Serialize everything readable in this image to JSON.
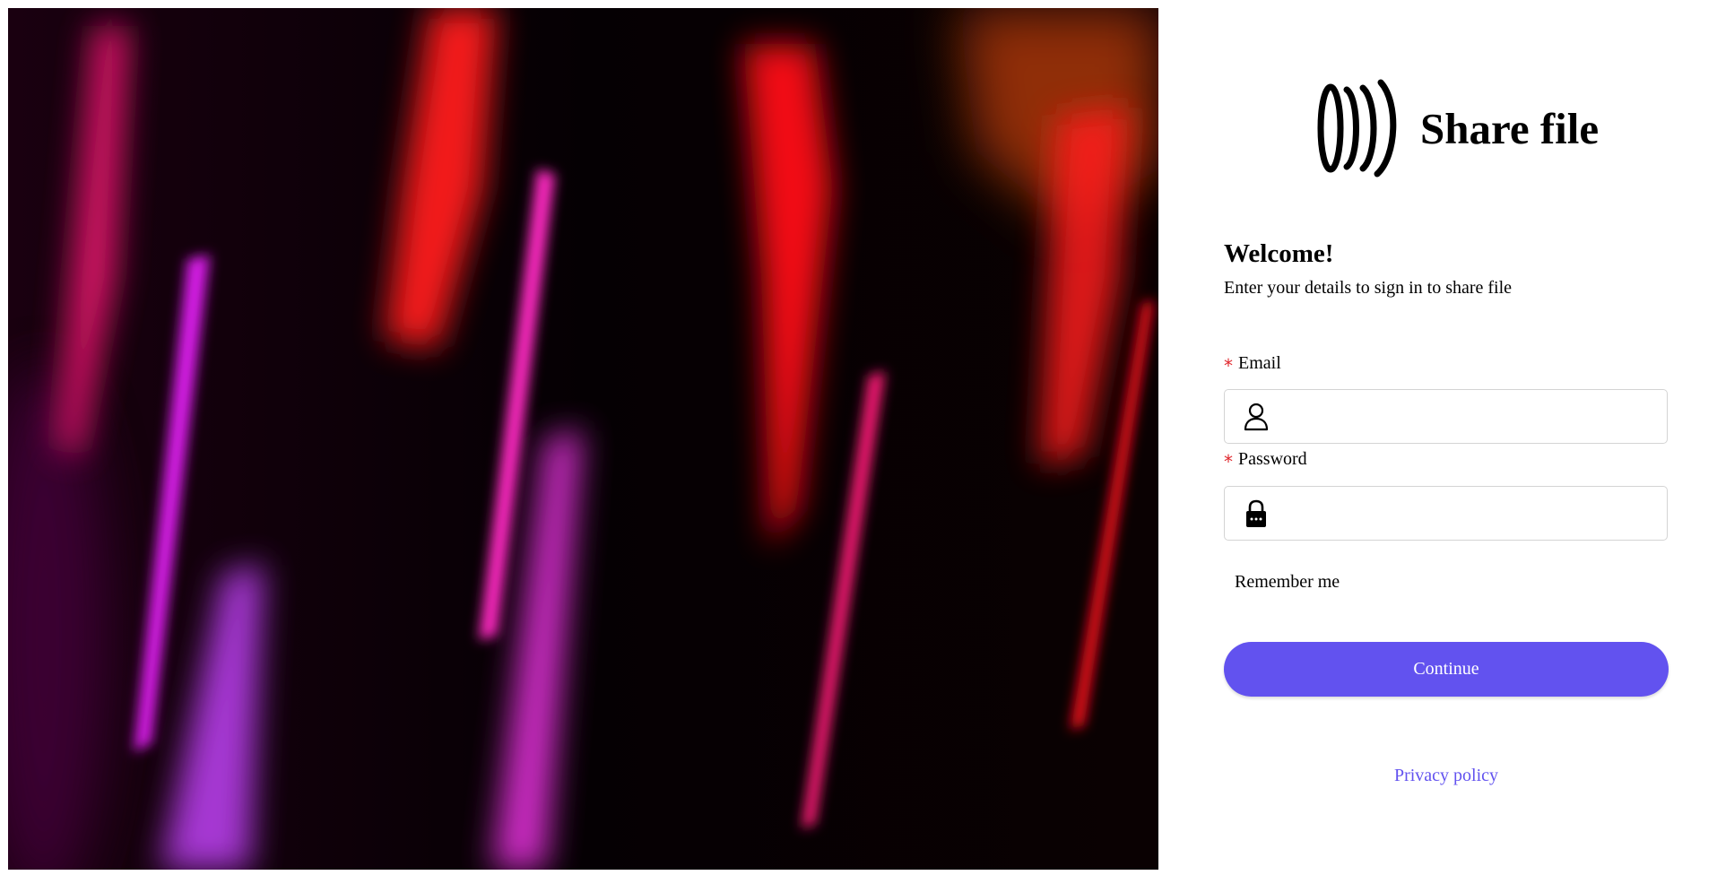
{
  "brand": {
    "name": "Share file",
    "logo_icon": "sound-waves-icon"
  },
  "hero": {
    "image": "abstract-light-streaks-image",
    "colors": [
      "#ff1493",
      "#d01ce0",
      "#ff0a18",
      "#ff4a10"
    ]
  },
  "form": {
    "welcome": "Welcome!",
    "subtitle": "Enter your details to sign in to share file",
    "required_marker": "*",
    "email": {
      "label": "Email",
      "value": "",
      "icon": "user-icon"
    },
    "password": {
      "label": "Password",
      "value": "",
      "icon": "lock-icon"
    },
    "remember_label": "Remember me",
    "continue_label": "Continue",
    "privacy_label": "Privacy policy"
  },
  "colors": {
    "accent": "#6252ef",
    "required": "#e0282e",
    "input_border": "#d4d4d4"
  }
}
